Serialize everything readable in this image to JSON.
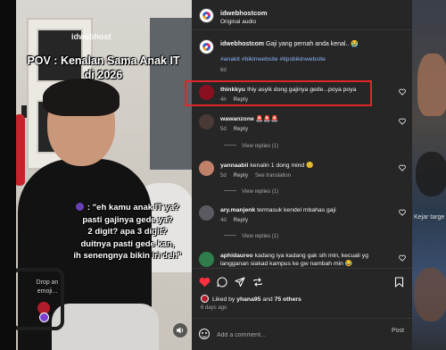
{
  "video": {
    "watermark": "idwebhost",
    "pov_title": "POV : Kenalan Sama Anak IT di 2026",
    "quote_lines": [
      ": \"eh kamu anak IT ya?",
      "pasti gajinya gede ya?",
      "2 digit? apa 3 digit?",
      "duitnya pasti gede kan,",
      "ih senengnya bikin iri deh\""
    ],
    "drop_emoji": "Drop an emoji..."
  },
  "header": {
    "username": "idwebhostcom",
    "audio": "Original audio"
  },
  "caption": {
    "username": "idwebhostcom",
    "text": "Gaji yang pernah anda kenal.. 😭",
    "tags": "#anakit #bikinwebsite #tipsbikinwebsite",
    "time": "6d"
  },
  "comments": [
    {
      "user": "thinkkyu",
      "text": "Ihiy asyik dong gajinya gede...poya poya",
      "time": "4h",
      "reply": "Reply",
      "avatar_color": "#8a1020"
    },
    {
      "user": "wawanzone",
      "text": "🚨🚨🚨",
      "time": "5d",
      "reply": "Reply",
      "view_replies": "View replies (1)",
      "avatar_color": "#4a3a35"
    },
    {
      "user": "yannaabii",
      "text": "kenalin 1 dong mind 😊",
      "time": "5d",
      "reply": "Reply",
      "translation": "See translation",
      "view_replies": "View replies (1)",
      "avatar_color": "#c0806a"
    },
    {
      "user": "ary.manjenk",
      "text": "termasuk kendel mbahas gaji",
      "time": "4d",
      "reply": "Reply",
      "view_replies": "View replies (1)",
      "avatar_color": "#5a5a60"
    },
    {
      "user": "aphidaureo",
      "text": "kadang iya kadang gak sih min, kecuali yg",
      "text2": "langganan siakad kampus ke gw nambah min 😂",
      "time": "",
      "avatar_color": "#2e7d4a"
    }
  ],
  "likes": {
    "prefix": "Liked by",
    "user": "yhana95",
    "and": "and",
    "others": "75 others",
    "ago": "6 days ago"
  },
  "comment_box": {
    "placeholder": "Add a comment...",
    "post": "Post"
  },
  "right_strip_text": "Kejar targe"
}
